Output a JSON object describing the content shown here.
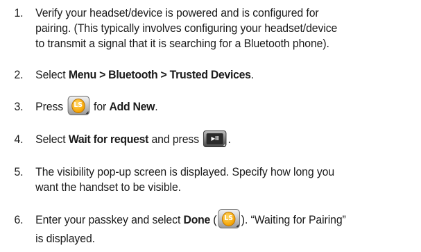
{
  "steps": [
    {
      "num": "1.",
      "lines": [
        "Verify your headset/device is powered and is configured for",
        "pairing. (This typically involves configuring your headset/device",
        "to transmit a signal that it is searching for a Bluetooth phone)."
      ]
    },
    {
      "num": "2.",
      "pre": "Select ",
      "bold": "Menu > Bluetooth > Trusted Devices",
      "post": "."
    },
    {
      "num": "3.",
      "pre": "Press ",
      "icon_label": "LS",
      "mid": " for ",
      "bold": "Add New",
      "post": "."
    },
    {
      "num": "4.",
      "pre": "Select ",
      "bold": "Wait for request",
      "mid": " and press ",
      "icon_label": "▶II",
      "post": "."
    },
    {
      "num": "5.",
      "lines": [
        "The visibility pop-up screen is displayed. Specify how long you",
        "want the handset to be visible."
      ]
    },
    {
      "num": "6.",
      "pre": "Enter your passkey and select ",
      "bold": "Done",
      "mid": " (",
      "icon_label": "LS",
      "post": "). “Waiting for Pairing”",
      "line2": "is displayed."
    }
  ],
  "icons": {
    "softkey": "left-softkey-icon",
    "play": "play-pause-key-icon"
  },
  "colors": {
    "text": "#1a1a1a",
    "softkey_accent": "#f5a300"
  }
}
